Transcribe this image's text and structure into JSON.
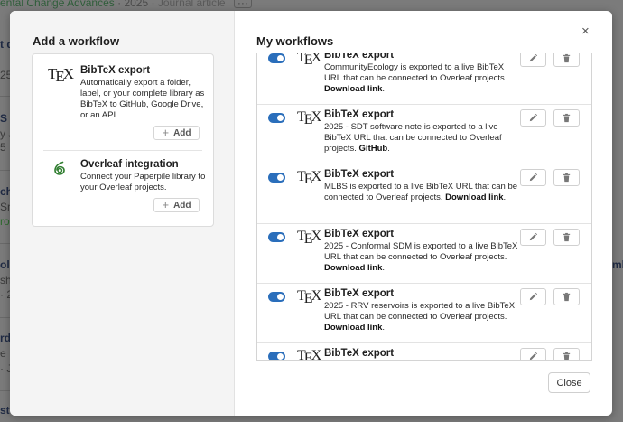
{
  "background": {
    "top_line": {
      "title": "ental Change Advances",
      "year": "· 2025 ·",
      "type": "Journal article",
      "menu": "···"
    },
    "fragments": [
      "t d",
      "25",
      "S",
      "y J",
      "5 ·",
      "ch",
      "Sno",
      "ro",
      "olu",
      "sh",
      "· 2",
      "rd",
      "e M",
      "· J",
      "ste"
    ],
    "right_fragment": "mb"
  },
  "left_pane": {
    "title": "Add a workflow",
    "items": [
      {
        "logo": "TEX",
        "title": "BibTeX export",
        "description": "Automatically export a folder, label, or your complete library as BibTeX to GitHub, Google Drive, or an API.",
        "button": "Add"
      },
      {
        "logo": "overleaf-logo-icon",
        "title": "Overleaf integration",
        "description": "Connect your Paperpile library to your Overleaf projects.",
        "button": "Add"
      }
    ]
  },
  "right_pane": {
    "title": "My workflows",
    "workflows": [
      {
        "title": "BibTeX export",
        "description": "CommunityEcology is exported to a live BibTeX URL that can be connected to Overleaf projects.",
        "link": "Download link",
        "enabled": true
      },
      {
        "title": "BibTeX export",
        "description": "2025 - SDT software note is exported to a live BibTeX URL that can be connected to Overleaf projects.",
        "link": "GitHub",
        "enabled": true
      },
      {
        "title": "BibTeX export",
        "description": "MLBS is exported to a live BibTeX URL that can be connected to Overleaf projects.",
        "link": "Download link",
        "enabled": true
      },
      {
        "title": "BibTeX export",
        "description": "2025 - Conformal SDM is exported to a live BibTeX URL that can be connected to Overleaf projects.",
        "link": "Download link",
        "enabled": true
      },
      {
        "title": "BibTeX export",
        "description": "2025 - RRV reservoirs is exported to a live BibTeX URL that can be connected to Overleaf projects.",
        "link": "Download link",
        "enabled": true
      },
      {
        "title": "BibTeX export",
        "description": "",
        "link": "",
        "enabled": true
      }
    ]
  },
  "close_label": "Close",
  "close_x": "×",
  "icons": {
    "edit": "pencil-icon",
    "delete": "trash-icon",
    "tex": "TEX"
  },
  "colors": {
    "accent": "#2a6ebb",
    "overleaf_green": "#2f7d2f"
  }
}
